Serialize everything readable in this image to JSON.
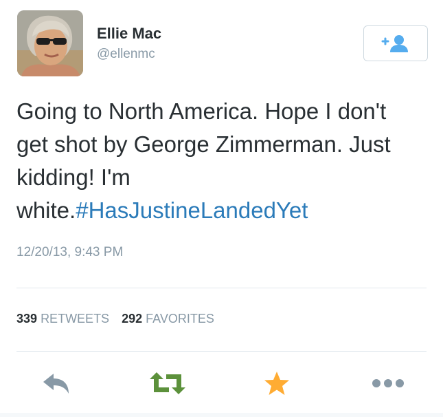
{
  "user": {
    "display_name": "Ellie Mac",
    "username": "@ellenmc"
  },
  "tweet": {
    "text": "Going to North America. Hope I don't get shot by George Zimmerman. Just kidding! I'm white.",
    "hashtag": "#HasJustineLandedYet",
    "timestamp": "12/20/13, 9:43 PM"
  },
  "stats": {
    "retweets_count": "339",
    "retweets_label": "RETWEETS",
    "favorites_count": "292",
    "favorites_label": "FAVORITES"
  },
  "icons": {
    "follow": "add-user-icon",
    "reply": "reply-icon",
    "retweet": "retweet-icon",
    "favorite": "star-icon",
    "more": "more-icon"
  },
  "colors": {
    "link": "#2b7bb9",
    "icon_blue": "#55acee",
    "retweet_green": "#5c913b",
    "favorite_gold": "#ffac33",
    "muted_text": "#8899a6",
    "action_gray": "#8899a6"
  }
}
